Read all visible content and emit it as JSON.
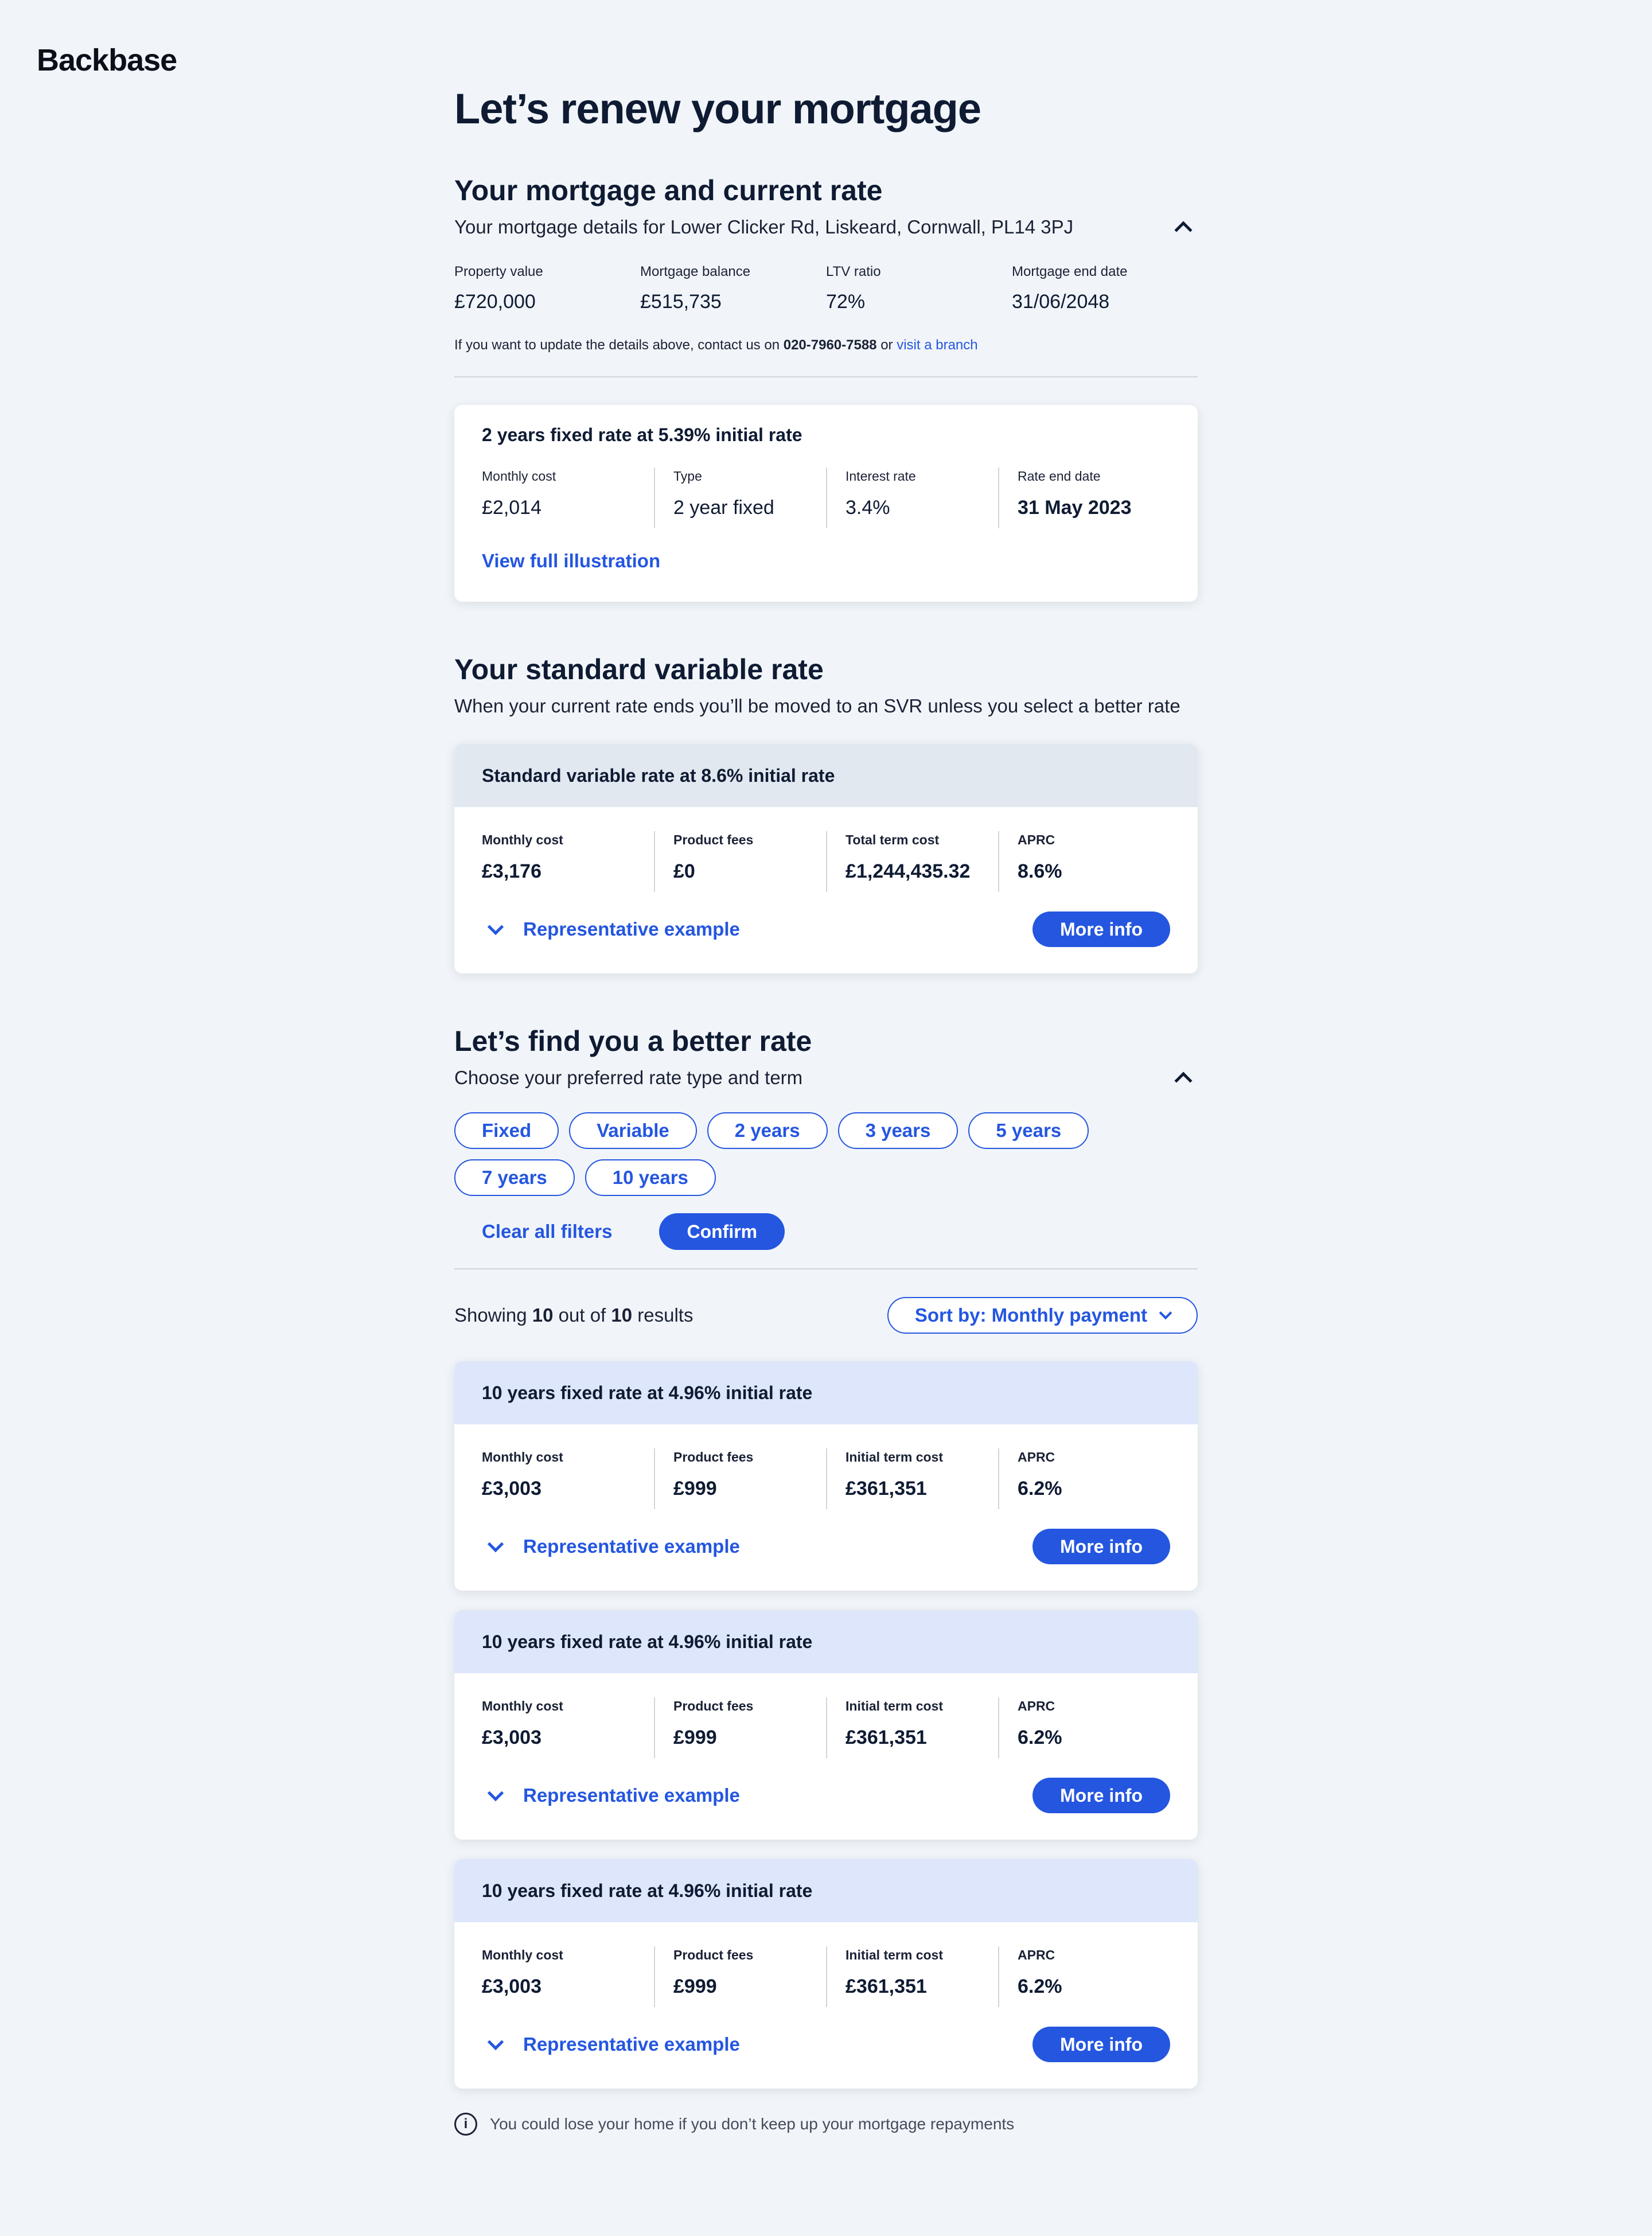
{
  "brand": {
    "logo": "Backbase"
  },
  "page_title": "Let’s renew your mortgage",
  "current": {
    "heading": "Your mortgage and current rate",
    "subtitle": "Your mortgage details for Lower Clicker Rd, Liskeard, Cornwall, PL14 3PJ",
    "details": [
      {
        "label": "Property value",
        "value": "£720,000"
      },
      {
        "label": "Mortgage balance",
        "value": "£515,735"
      },
      {
        "label": "LTV ratio",
        "value": "72%"
      },
      {
        "label": "Mortgage end date",
        "value": "31/06/2048"
      }
    ],
    "contact_prefix": "If you want to update the details above, contact us on ",
    "contact_phone": "020-7960-7588",
    "contact_or": " or ",
    "contact_link": "visit a branch",
    "rate_card": {
      "title": "2 years fixed rate at 5.39% initial rate",
      "stats": [
        {
          "label": "Monthly cost",
          "value": "£2,014"
        },
        {
          "label": "Type",
          "value": "2 year fixed"
        },
        {
          "label": "Interest rate",
          "value": "3.4%"
        },
        {
          "label": "Rate end date",
          "value": "31 May 2023"
        }
      ],
      "link": "View full illustration"
    }
  },
  "svr": {
    "heading": "Your standard variable rate",
    "subtitle": "When your current rate ends you’ll be moved to an SVR unless you select a better rate",
    "card": {
      "title": "Standard variable rate at 8.6% initial rate",
      "stats": [
        {
          "label": "Monthly cost",
          "value": "£3,176"
        },
        {
          "label": "Product fees",
          "value": "£0"
        },
        {
          "label": "Total term cost",
          "value": "£1,244,435.32"
        },
        {
          "label": "APRC",
          "value": "8.6%"
        }
      ],
      "rep_example": "Representative example",
      "more_info": "More info"
    }
  },
  "better": {
    "heading": "Let’s find you a better rate",
    "subtitle": "Choose your preferred rate type and term",
    "chips": [
      "Fixed",
      "Variable",
      "2 years",
      "3 years",
      "5 years",
      "7 years",
      "10 years"
    ],
    "clear_filters": "Clear all filters",
    "confirm": "Confirm",
    "showing_prefix": "Showing ",
    "showing_count": "10",
    "showing_mid": " out of ",
    "showing_total": "10",
    "showing_suffix": " results",
    "sort_label": "Sort by: Monthly payment",
    "results": [
      {
        "title": "10 years fixed rate at 4.96% initial rate",
        "stats": [
          {
            "label": "Monthly cost",
            "value": "£3,003"
          },
          {
            "label": "Product fees",
            "value": "£999"
          },
          {
            "label": "Initial term cost",
            "value": "£361,351"
          },
          {
            "label": "APRC",
            "value": "6.2%"
          }
        ],
        "rep_example": "Representative example",
        "more_info": "More info"
      },
      {
        "title": "10 years fixed rate at 4.96% initial rate",
        "stats": [
          {
            "label": "Monthly cost",
            "value": "£3,003"
          },
          {
            "label": "Product fees",
            "value": "£999"
          },
          {
            "label": "Initial term cost",
            "value": "£361,351"
          },
          {
            "label": "APRC",
            "value": "6.2%"
          }
        ],
        "rep_example": "Representative example",
        "more_info": "More info"
      },
      {
        "title": "10 years fixed rate at 4.96% initial rate",
        "stats": [
          {
            "label": "Monthly cost",
            "value": "£3,003"
          },
          {
            "label": "Product fees",
            "value": "£999"
          },
          {
            "label": "Initial term cost",
            "value": "£361,351"
          },
          {
            "label": "APRC",
            "value": "6.2%"
          }
        ],
        "rep_example": "Representative example",
        "more_info": "More info"
      }
    ]
  },
  "warning": "You could lose your home if you don’t keep up your mortgage repayments",
  "icons": {
    "info": "info-icon",
    "chevron_up": "chevron-up-icon",
    "chevron_down": "chevron-down-icon"
  },
  "colors": {
    "accent": "#2456e0",
    "background": "#f1f5f9",
    "svr_header": "#e2e8f0",
    "result_header": "#dde6fb"
  }
}
